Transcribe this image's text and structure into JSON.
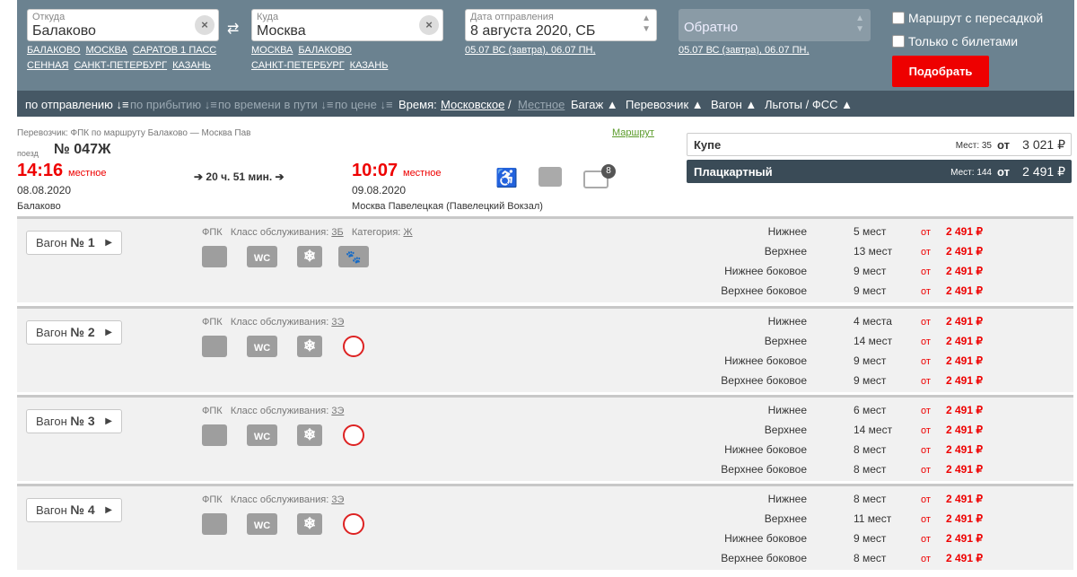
{
  "search": {
    "from": {
      "label": "Откуда",
      "value": "Балаково",
      "links": [
        "БАЛАКОВО",
        "МОСКВА",
        "САРАТОВ 1 ПАСС",
        "СЕННАЯ",
        "САНКТ-ПЕТЕРБУРГ",
        "КАЗАНЬ"
      ]
    },
    "to": {
      "label": "Куда",
      "value": "Москва",
      "links": [
        "МОСКВА",
        "БАЛАКОВО",
        "САНКТ-ПЕТЕРБУРГ",
        "КАЗАНЬ"
      ]
    },
    "date": {
      "label": "Дата отправления",
      "value": "8 августа 2020, СБ",
      "quick": "05.07 ВС (завтра), 06.07 ПН,"
    },
    "return": {
      "placeholder": "Обратно",
      "quick": "05.07 ВС (завтра), 06.07 ПН,"
    },
    "transfer_label": "Маршрут с пересадкой",
    "tickets_only_label": "Только с билетами",
    "submit_label": "Подобрать"
  },
  "sortbar": {
    "by_departure": "по отправлению",
    "by_arrival": "по прибытию",
    "by_travel_time": "по времени в пути",
    "by_price": "по цене",
    "time_label": "Время:",
    "time_moscow": "Московское",
    "time_sep": "/",
    "time_local": "Местное",
    "baggage": "Багаж",
    "carrier": "Перевозчик",
    "wagon": "Вагон",
    "benefits": "Льготы / ФСС"
  },
  "train": {
    "carrier_line": "Перевозчик: ФПК   по маршруту Балаково — Москва Пав",
    "route_link": "Маршрут",
    "train_prefix": "поезд",
    "number": "№ 047Ж",
    "dep_time": "14:16",
    "dep_suffix": "местное",
    "dep_date": "08.08.2020",
    "dep_station": "Балаково",
    "duration": "➔ 20 ч. 51 мин. ➔",
    "arr_time": "10:07",
    "arr_suffix": "местное",
    "arr_date": "09.08.2020",
    "arr_station": "Москва Павелецкая (Павелецкий Вокзал)",
    "wagons_badge": "8"
  },
  "classes": [
    {
      "name": "Купе",
      "seats": "Мест: 35",
      "from": "от",
      "price": "3 021 ₽"
    },
    {
      "name": "Плацкартный",
      "seats": "Мест: 144",
      "from": "от",
      "price": "2 491 ₽"
    }
  ],
  "wagons": [
    {
      "label": "Вагон",
      "num": "№ 1",
      "carrier": "ФПК",
      "service_label": "Класс обслуживания:",
      "service": "3Б",
      "category_label": "Категория:",
      "category": "Ж",
      "pets": true,
      "rows": [
        {
          "type": "Нижнее",
          "count": "5 мест",
          "from": "от",
          "price": "2 491 ₽"
        },
        {
          "type": "Верхнее",
          "count": "13 мест",
          "from": "от",
          "price": "2 491 ₽"
        },
        {
          "type": "Нижнее боковое",
          "count": "9 мест",
          "from": "от",
          "price": "2 491 ₽"
        },
        {
          "type": "Верхнее боковое",
          "count": "9 мест",
          "from": "от",
          "price": "2 491 ₽"
        }
      ]
    },
    {
      "label": "Вагон",
      "num": "№ 2",
      "carrier": "ФПК",
      "service_label": "Класс обслуживания:",
      "service": "3Э",
      "pets": false,
      "rows": [
        {
          "type": "Нижнее",
          "count": "4 места",
          "from": "от",
          "price": "2 491 ₽"
        },
        {
          "type": "Верхнее",
          "count": "14 мест",
          "from": "от",
          "price": "2 491 ₽"
        },
        {
          "type": "Нижнее боковое",
          "count": "9 мест",
          "from": "от",
          "price": "2 491 ₽"
        },
        {
          "type": "Верхнее боковое",
          "count": "9 мест",
          "from": "от",
          "price": "2 491 ₽"
        }
      ]
    },
    {
      "label": "Вагон",
      "num": "№ 3",
      "carrier": "ФПК",
      "service_label": "Класс обслуживания:",
      "service": "3Э",
      "pets": false,
      "rows": [
        {
          "type": "Нижнее",
          "count": "6 мест",
          "from": "от",
          "price": "2 491 ₽"
        },
        {
          "type": "Верхнее",
          "count": "14 мест",
          "from": "от",
          "price": "2 491 ₽"
        },
        {
          "type": "Нижнее боковое",
          "count": "8 мест",
          "from": "от",
          "price": "2 491 ₽"
        },
        {
          "type": "Верхнее боковое",
          "count": "8 мест",
          "from": "от",
          "price": "2 491 ₽"
        }
      ]
    },
    {
      "label": "Вагон",
      "num": "№ 4",
      "carrier": "ФПК",
      "service_label": "Класс обслуживания:",
      "service": "3Э",
      "pets": false,
      "rows": [
        {
          "type": "Нижнее",
          "count": "8 мест",
          "from": "от",
          "price": "2 491 ₽"
        },
        {
          "type": "Верхнее",
          "count": "11 мест",
          "from": "от",
          "price": "2 491 ₽"
        },
        {
          "type": "Нижнее боковое",
          "count": "9 мест",
          "from": "от",
          "price": "2 491 ₽"
        },
        {
          "type": "Верхнее боковое",
          "count": "8 мест",
          "from": "от",
          "price": "2 491 ₽"
        }
      ]
    }
  ],
  "icons": {
    "baggage": "baggage-icon",
    "wc": "wc-icon",
    "ac": "snowflake-icon",
    "pets": "paw-icon",
    "no_pets": "no-pets-icon",
    "accessible": "wheelchair-icon",
    "wagon": "wagon-icon"
  },
  "colors": {
    "header": "#6b8290",
    "sortbar": "#465865",
    "accent": "#e00000",
    "selected_class": "#3a4b57"
  }
}
